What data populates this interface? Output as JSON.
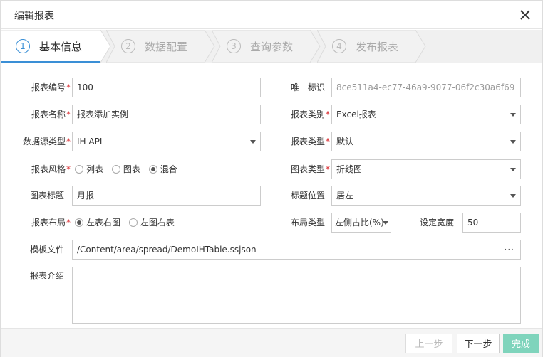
{
  "dialog": {
    "title": "编辑报表"
  },
  "steps": [
    {
      "num": "1",
      "label": "基本信息"
    },
    {
      "num": "2",
      "label": "数据配置"
    },
    {
      "num": "3",
      "label": "查询参数"
    },
    {
      "num": "4",
      "label": "发布报表"
    }
  ],
  "form": {
    "report_no": {
      "label": "报表编号",
      "value": "100"
    },
    "unique_id": {
      "label": "唯一标识",
      "value": "8ce511a4-ec77-46a9-9077-06f2c30a6f69"
    },
    "report_name": {
      "label": "报表名称",
      "value": "报表添加实例"
    },
    "report_category": {
      "label": "报表类别",
      "value": "Excel报表"
    },
    "datasource_type": {
      "label": "数据源类型",
      "value": "IH API"
    },
    "report_type": {
      "label": "报表类型",
      "value": "默认"
    },
    "report_style": {
      "label": "报表风格",
      "options": [
        "列表",
        "图表",
        "混合"
      ],
      "selected": "混合"
    },
    "chart_type": {
      "label": "图表类型",
      "value": "折线图"
    },
    "chart_title": {
      "label": "图表标题",
      "value": "月报"
    },
    "title_position": {
      "label": "标题位置",
      "value": "居左"
    },
    "report_layout": {
      "label": "报表布局",
      "options": [
        "左表右图",
        "左图右表"
      ],
      "selected": "左表右图"
    },
    "layout_type": {
      "label": "布局类型",
      "value": "左侧占比(%)"
    },
    "set_width": {
      "label": "设定宽度",
      "value": "50"
    },
    "template_file": {
      "label": "模板文件",
      "value": "/Content/area/spread/DemoIHTable.ssjson",
      "browse": "···"
    },
    "report_intro": {
      "label": "报表介绍",
      "value": ""
    }
  },
  "footer": {
    "prev": "上一步",
    "next": "下一步",
    "finish": "完成"
  },
  "colors": {
    "accent": "#3a8fd6",
    "required": "#d9262b",
    "finish": "#7fd4bc"
  }
}
